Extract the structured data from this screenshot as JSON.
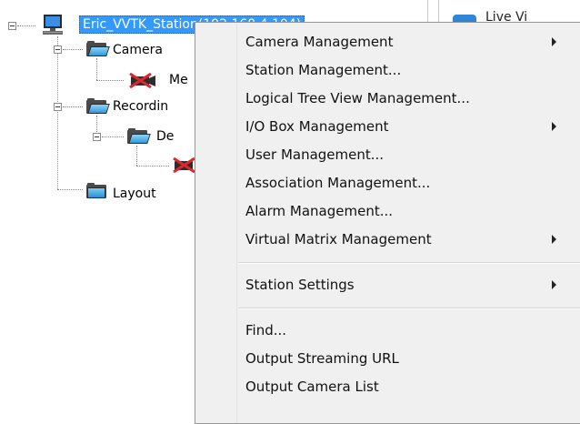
{
  "tree": {
    "root_label": "Eric_VVTK_Station(192.168.4.104)",
    "nodes": {
      "camera": "Camera",
      "camera_child": "Me",
      "recording": "Recordin",
      "recording_child": "De",
      "layout": "Layout"
    }
  },
  "right_panel": {
    "tab_fragment": "Live Vi"
  },
  "context_menu": {
    "items": [
      {
        "label": "Camera Management",
        "submenu": true
      },
      {
        "label": "Station Management...",
        "submenu": false
      },
      {
        "label": "Logical Tree View Management...",
        "submenu": false
      },
      {
        "label": "I/O Box Management",
        "submenu": true
      },
      {
        "label": "User Management...",
        "submenu": false
      },
      {
        "label": "Association Management...",
        "submenu": false
      },
      {
        "label": "Alarm Management...",
        "submenu": false
      },
      {
        "label": "Virtual Matrix Management",
        "submenu": true
      },
      {
        "label": "Station Settings",
        "submenu": true
      },
      {
        "label": "Find...",
        "submenu": false
      },
      {
        "label": "Output Streaming URL",
        "submenu": false
      },
      {
        "label": "Output Camera List",
        "submenu": false
      }
    ]
  },
  "colors": {
    "selection": "#3399ff",
    "menu_background": "#f0f0f0",
    "folder_blue": "#2f9be0",
    "disabled_x": "#e0262a"
  }
}
